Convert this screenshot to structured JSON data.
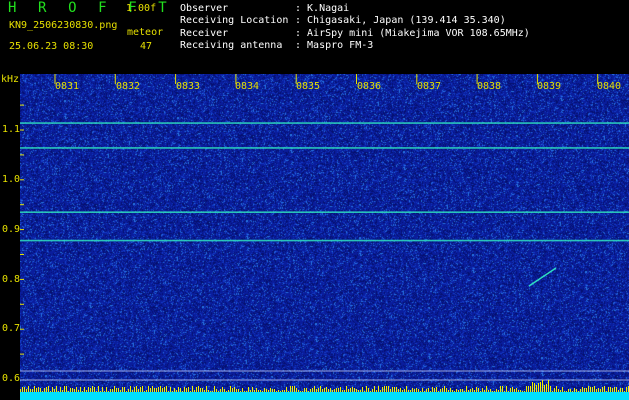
{
  "header": {
    "app_title": "H R O F F T",
    "version": "1.00f",
    "filename": "KN9_2506230830.png",
    "datetime": "25.06.23 08:30",
    "meteor_label": "meteor",
    "meteor_count": "47",
    "info": [
      {
        "key": "Observer",
        "value": ": K.Nagai"
      },
      {
        "key": "Receiving Location",
        "value": ": Chigasaki, Japan (139.414 35.340)"
      },
      {
        "key": "Receiver",
        "value": ": AirSpy mini (Miakejima VOR 108.65MHz)"
      },
      {
        "key": "Receiving antenna",
        "value": ": Maspro FM-3"
      }
    ]
  },
  "spectrogram": {
    "unit_label": "kHz",
    "time_labels": [
      "0831",
      "0832",
      "0833",
      "0834",
      "0835",
      "0836",
      "0837",
      "0838",
      "0839",
      "0840"
    ],
    "freq_labels": [
      "1.1",
      "1.0",
      "0.9",
      "0.8",
      "0.7",
      "0.6"
    ],
    "freq_range_khz": [
      0.59,
      1.19
    ],
    "carrier_lines_khz": [
      1.114,
      1.064,
      0.935,
      0.878
    ],
    "colors": {
      "background": "#0a1d9c",
      "carrier": "#2fe0c0",
      "text": "#e6e000",
      "bottom_band": "#00e0ff"
    }
  }
}
